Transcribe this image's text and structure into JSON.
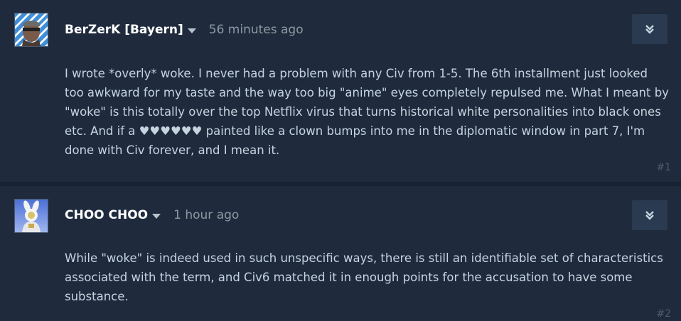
{
  "posts": [
    {
      "author": "BerZerK [Bayern]",
      "timestamp": "56 minutes ago",
      "paragraphs": [
        "I wrote *overly* woke. I never had a problem with any Civ from 1-5. The 6th installment just looked too awkward for my taste and the way too big \"anime\" eyes completely repulsed me. What I meant by \"woke\" is this totally over the top Netflix virus that turns historical white personalities into black ones etc. And if a ♥♥♥♥♥♥ painted like a clown bumps into me in the diplomatic window in part 7, I'm done with Civ forever, and I mean it."
      ],
      "number": "#1",
      "avatar_icon": "user-avatar-bavarian-flag"
    },
    {
      "author": "CHOO CHOO",
      "timestamp": "1 hour ago",
      "paragraphs": [
        "While \"woke\" is indeed used in such unspecific ways, there is still an identifiable set of characteristics associated with the term, and Civ6 matched it in enough points for the accusation to have some substance."
      ],
      "number": "#2",
      "avatar_icon": "user-avatar-astronaut"
    }
  ],
  "icons": {
    "menu": "double-chevron-down-icon",
    "author_dropdown": "caret-down-icon"
  },
  "colors": {
    "background": "#1b2838",
    "post_background": "#1f2b3d",
    "author": "#ffffff",
    "timestamp": "#8f98a0",
    "body_text": "#c6d4df",
    "post_number": "#4f5c6b",
    "menu_button": "#2a3a50"
  }
}
